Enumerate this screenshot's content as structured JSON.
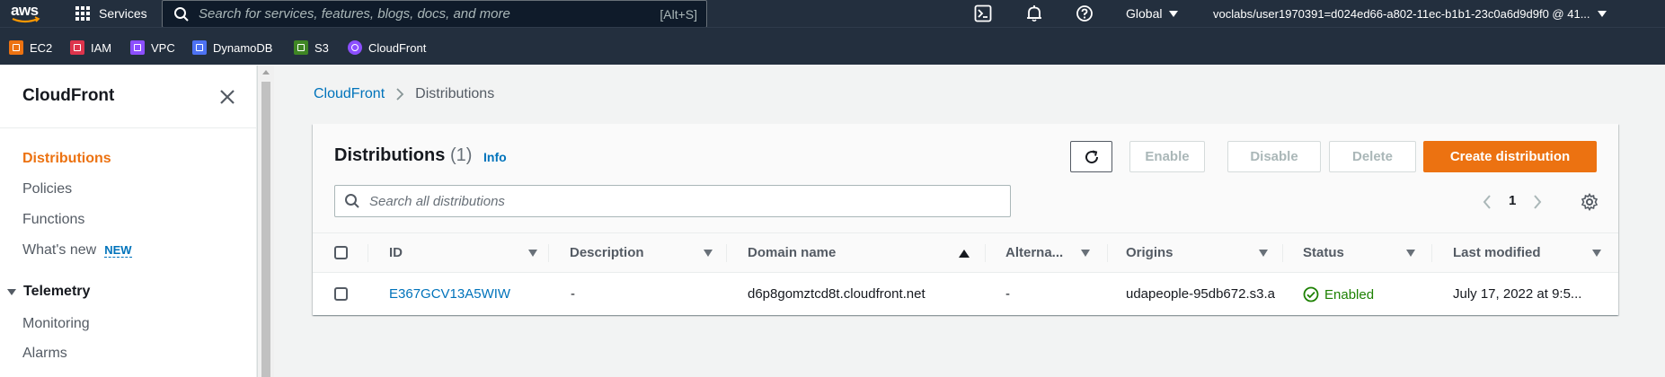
{
  "topnav": {
    "logo_text": "aws",
    "services_label": "Services",
    "search_placeholder": "Search for services, features, blogs, docs, and more",
    "search_shortcut": "[Alt+S]",
    "region_label": "Global",
    "account_label": "voclabs/user1970391=d024ed66-a802-11ec-b1b1-23c0a6d9d9f0 @ 41...",
    "colors": {
      "bg": "#232f3e"
    }
  },
  "favorites": [
    {
      "label": "EC2",
      "icon": "ec2-icon",
      "color": "#ec7211"
    },
    {
      "label": "IAM",
      "icon": "iam-icon",
      "color": "#dd344c"
    },
    {
      "label": "VPC",
      "icon": "vpc-icon",
      "color": "#8c4fff"
    },
    {
      "label": "DynamoDB",
      "icon": "dynamodb-icon",
      "color": "#4d72f3"
    },
    {
      "label": "S3",
      "icon": "s3-icon",
      "color": "#3f8624"
    },
    {
      "label": "CloudFront",
      "icon": "cloudfront-icon",
      "color": "#8c4fff"
    }
  ],
  "sidebar": {
    "title": "CloudFront",
    "items": [
      {
        "label": "Distributions",
        "active": true
      },
      {
        "label": "Policies"
      },
      {
        "label": "Functions"
      },
      {
        "label": "What's new",
        "badge": "NEW"
      }
    ],
    "section": {
      "label": "Telemetry",
      "items": [
        {
          "label": "Monitoring"
        },
        {
          "label": "Alarms"
        }
      ]
    }
  },
  "breadcrumb": {
    "root": "CloudFront",
    "current": "Distributions"
  },
  "panel": {
    "title": "Distributions",
    "count": "(1)",
    "info": "Info",
    "buttons": {
      "enable": "Enable",
      "disable": "Disable",
      "delete": "Delete",
      "create": "Create distribution"
    },
    "search_placeholder": "Search all distributions",
    "page_number": "1",
    "columns": [
      "ID",
      "Description",
      "Domain name",
      "Alterna...",
      "Origins",
      "Status",
      "Last modified"
    ],
    "rows": [
      {
        "id": "E367GCV13A5WIW",
        "description": "-",
        "domain": "d6p8gomztcd8t.cloudfront.net",
        "alternate": "-",
        "origins": "udapeople-95db672.s3.a",
        "status": "Enabled",
        "last_modified": "July 17, 2022 at 9:5..."
      }
    ],
    "colors": {
      "primary": "#ec7211",
      "link": "#0073bb",
      "success": "#1d8102"
    }
  }
}
